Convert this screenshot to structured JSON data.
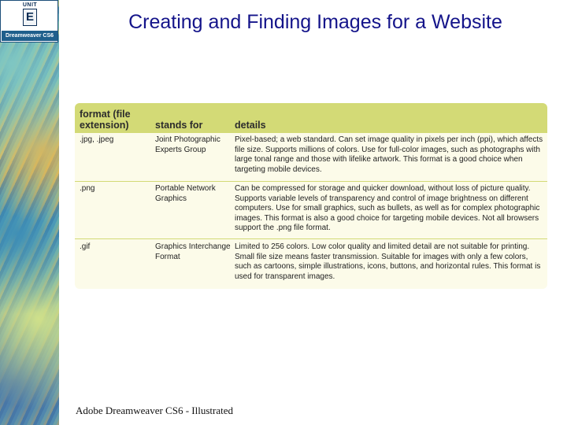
{
  "badge": {
    "unit_label": "UNIT",
    "unit_letter": "E",
    "product": "Dreamweaver CS6"
  },
  "title": "Creating and Finding Images for a Website",
  "table": {
    "headers": {
      "format": "format (file extension)",
      "stands_for": "stands for",
      "details": "details"
    },
    "rows": [
      {
        "format": ".jpg, .jpeg",
        "stands_for": "Joint Photographic Experts Group",
        "details": "Pixel-based; a web standard. Can set image quality in pixels per inch (ppi), which affects file size. Supports millions of colors. Use for full-color images, such as photographs with large tonal range and those with lifelike artwork. This format is a good choice when targeting mobile devices."
      },
      {
        "format": ".png",
        "stands_for": "Portable Network Graphics",
        "details": "Can be compressed for storage and quicker download, without loss of picture quality. Supports variable levels of transparency and control of image brightness on different computers. Use for small graphics, such as bullets, as well as for complex photographic images. This format is also a good choice for targeting mobile devices. Not all browsers support the .png file format."
      },
      {
        "format": ".gif",
        "stands_for": "Graphics Interchange Format",
        "details": "Limited to 256 colors. Low color quality and limited detail are not suitable for printing. Small file size means faster transmission. Suitable for images with only a few colors, such as cartoons, simple illustrations, icons, buttons, and horizontal rules. This format is used for transparent images."
      }
    ]
  },
  "footer": "Adobe Dreamweaver CS6 - Illustrated"
}
